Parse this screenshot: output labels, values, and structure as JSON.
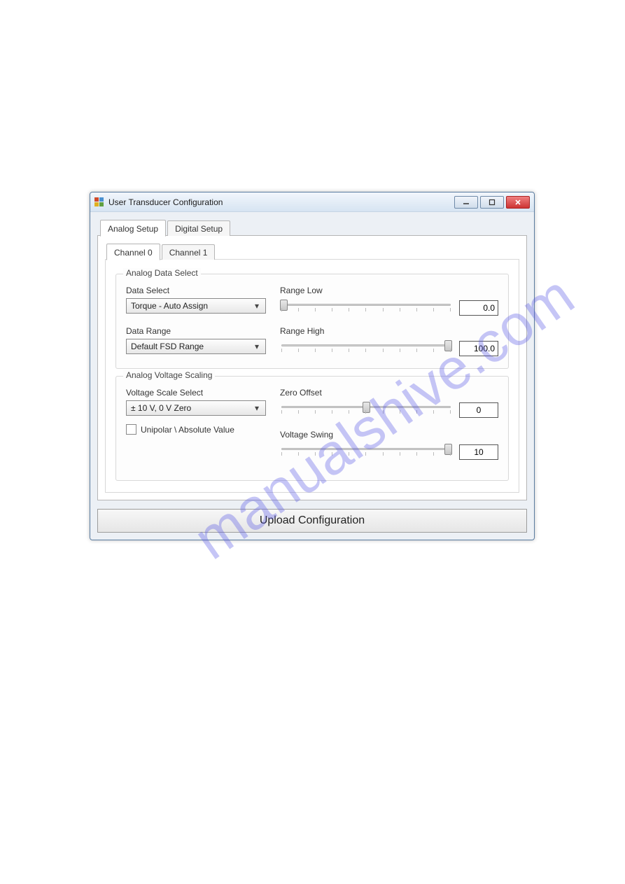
{
  "watermark": "manualshive.com",
  "window": {
    "title": "User Transducer Configuration"
  },
  "tabs_top": {
    "items": [
      {
        "label": "Analog Setup",
        "active": true
      },
      {
        "label": "Digital Setup",
        "active": false
      }
    ]
  },
  "tabs_channel": {
    "items": [
      {
        "label": "Channel 0",
        "active": true
      },
      {
        "label": "Channel 1",
        "active": false
      }
    ]
  },
  "group_data_select": {
    "legend": "Analog Data Select",
    "data_select_label": "Data Select",
    "data_select_value": "Torque - Auto Assign",
    "data_range_label": "Data Range",
    "data_range_value": "Default FSD Range",
    "range_low_label": "Range Low",
    "range_low_value": "0.0",
    "range_high_label": "Range High",
    "range_high_value": "100.0"
  },
  "group_voltage": {
    "legend": "Analog Voltage Scaling",
    "scale_select_label": "Voltage Scale Select",
    "scale_select_value": "± 10 V, 0 V Zero",
    "unipolar_label": "Unipolar \\ Absolute Value",
    "zero_offset_label": "Zero Offset",
    "zero_offset_value": "0",
    "voltage_swing_label": "Voltage Swing",
    "voltage_swing_value": "10"
  },
  "upload_button_label": "Upload Configuration"
}
